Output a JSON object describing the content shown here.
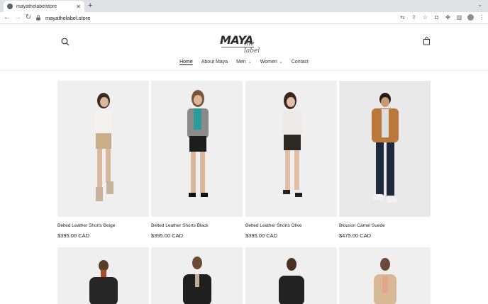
{
  "browser": {
    "tab_title": "mayathelabelstore",
    "url": "mayathelabel.store"
  },
  "store": {
    "logo_main": "MAYA",
    "logo_sub": "the label",
    "menu": [
      {
        "label": "Home"
      },
      {
        "label": "About Maya"
      },
      {
        "label": "Men",
        "caret": "⌄"
      },
      {
        "label": "Women",
        "caret": "⌄"
      },
      {
        "label": "Contact"
      }
    ]
  },
  "products": [
    {
      "name": "Belted Leather Shorts Beige",
      "price": "$395.00 CAD"
    },
    {
      "name": "Belted Leather Shorts Black",
      "price": "$395.00 CAD"
    },
    {
      "name": "Belted Leather Shorts Olive",
      "price": "$395.00 CAD"
    },
    {
      "name": "Blouson Camel Suede",
      "price": "$475.00 CAD"
    }
  ],
  "colors": {
    "chrome_bg": "#dee1e6",
    "image_bg": "#efefef",
    "text": "#222222"
  }
}
